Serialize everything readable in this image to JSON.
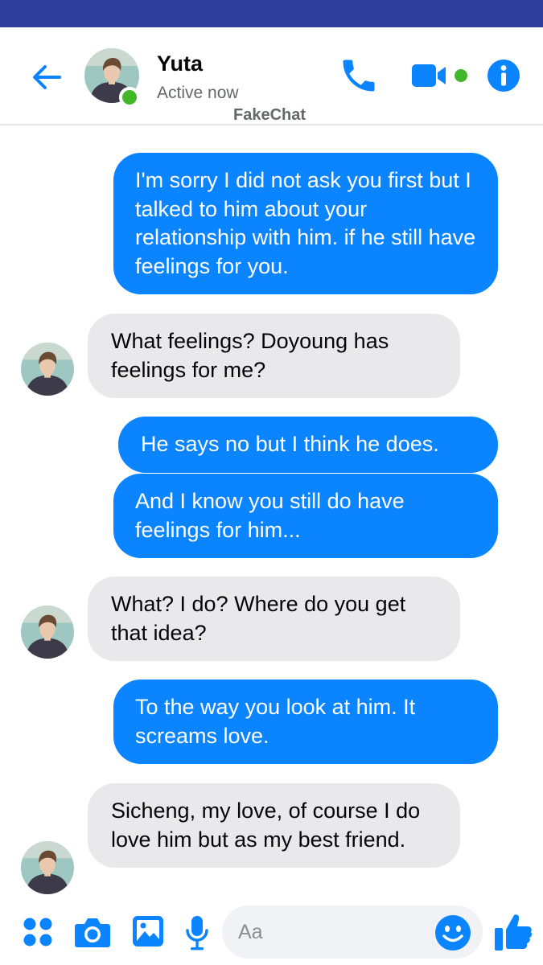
{
  "header": {
    "contact_name": "Yuta",
    "status": "Active now",
    "watermark": "FakeChat"
  },
  "messages": [
    {
      "direction": "outgoing",
      "text": "I'm sorry I did not ask you first but I talked to him about your relationship with him. if he still have feelings for you."
    },
    {
      "direction": "incoming",
      "text": "What feelings? Doyoung has feelings for me?"
    },
    {
      "direction": "outgoing",
      "text": "He says no but I think he does."
    },
    {
      "direction": "outgoing",
      "text": "And I know you still do have feelings for him..."
    },
    {
      "direction": "incoming",
      "text": "What? I do? Where do you get that idea?"
    },
    {
      "direction": "outgoing",
      "text": "To the way you look at him. It screams love."
    },
    {
      "direction": "incoming",
      "text": "Sicheng, my love, of course I do love him but as my best friend."
    }
  ],
  "composer": {
    "placeholder": "Aa",
    "value": ""
  },
  "colors": {
    "accent": "#0a84ff",
    "status_bar": "#2e3e9b",
    "online": "#42b72a",
    "incoming_bubble": "#e9e9eb"
  },
  "icons": {
    "back": "arrow-left-icon",
    "call": "phone-icon",
    "video": "video-camera-icon",
    "info": "info-icon",
    "apps": "four-dots-icon",
    "camera": "camera-icon",
    "gallery": "image-icon",
    "mic": "microphone-icon",
    "emoji": "smiley-icon",
    "like": "thumbs-up-icon"
  }
}
